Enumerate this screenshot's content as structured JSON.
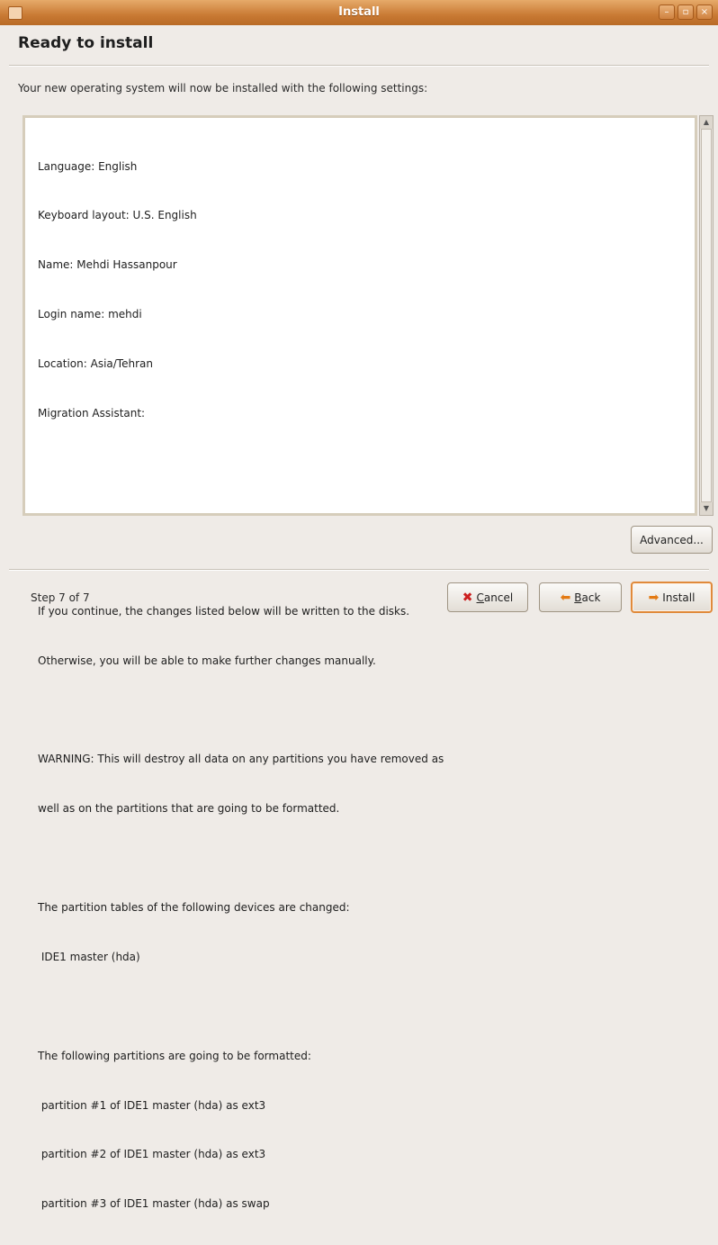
{
  "window": {
    "title": "Install",
    "controls": [
      "minimize-icon",
      "maximize-icon",
      "close-icon"
    ]
  },
  "heading": "Ready to install",
  "description": "Your new operating system will now be installed with the following settings:",
  "summary_lines": [
    "Language: English",
    "Keyboard layout: U.S. English",
    "Name: Mehdi Hassanpour",
    "Login name: mehdi",
    "Location: Asia/Tehran",
    "Migration Assistant:",
    "",
    "",
    "",
    "If you continue, the changes listed below will be written to the disks.",
    "Otherwise, you will be able to make further changes manually.",
    "",
    "WARNING: This will destroy all data on any partitions you have removed as",
    "well as on the partitions that are going to be formatted.",
    "",
    "The partition tables of the following devices are changed:",
    " IDE1 master (hda)",
    "",
    "The following partitions are going to be formatted:",
    " partition #1 of IDE1 master (hda) as ext3",
    " partition #2 of IDE1 master (hda) as ext3",
    " partition #3 of IDE1 master (hda) as swap"
  ],
  "buttons": {
    "advanced": "Advanced...",
    "cancel_mnemonic": "C",
    "cancel_rest": "ancel",
    "back_mnemonic": "B",
    "back_rest": "ack",
    "install": "Install"
  },
  "footer": {
    "step": "Step 7 of 7"
  },
  "colors": {
    "titlebar": "#c97a34",
    "default_button_border": "#e08a3b",
    "cancel_icon": "#cc2020"
  },
  "icons": {
    "cancel": "cancel-x-icon",
    "back": "back-arrow-icon",
    "install": "forward-arrow-icon"
  }
}
